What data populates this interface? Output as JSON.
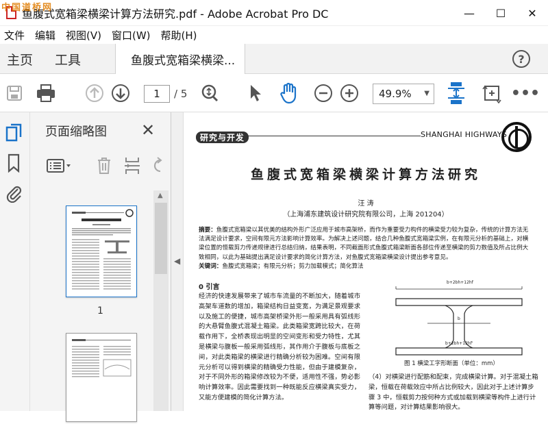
{
  "window": {
    "title": "鱼腹式宽箱梁横梁计算方法研究.pdf - Adobe Acrobat Pro DC",
    "watermark": "中国道桥网",
    "minimize": "—",
    "maximize": "☐",
    "close": "✕"
  },
  "menu": [
    "文件",
    "编辑",
    "视图(V)",
    "窗口(W)",
    "帮助(H)"
  ],
  "tabs": {
    "home": "主页",
    "tools": "工具",
    "document": "鱼腹式宽箱梁横梁..."
  },
  "toolbar": {
    "current_page": "1",
    "total_pages": "/ 5",
    "zoom": "49.9%"
  },
  "side_panel": {
    "title": "页面缩略图",
    "thumb_1_label": "1"
  },
  "paper": {
    "journal_cn": "研究与开发",
    "journal_en": "SHANGHAI HIGHWAYS",
    "title": "鱼腹式宽箱梁横梁计算方法研究",
    "author": "汪  涛",
    "affiliation": "（上海浦东建筑设计研究院有限公司，上海  201204）",
    "abstract_label": "摘要：",
    "abstract": "鱼腹式宽箱梁以其优美的结构外形广泛应用于城市高架桥，而作为重要受力构件的横梁受力较为复杂，传统的计算方法无法满足设计要求，空间有限元方法影响计算效率。为解决上述问题，结合几种鱼腹式宽箱梁实例，在有限元分析的基础上，对横梁位置的恒载剪力传递规律进行总结归纳，结果表明，不同截面形式鱼腹式箱梁断面各部位传递至横梁的剪力数值及所占比例大致相同，以此为基础提出满足设计要求的简化计算方法，对鱼腹式宽箱梁横梁设计提出参考意见。",
    "keywords_label": "关键词：",
    "keywords": "鱼腹式宽箱梁；有限元分析；剪力加载模式；简化算法",
    "section_head": "0   引言",
    "body_left": "经济的快速发展带来了城市车流量的不断加大，随着城市高架车道数的增加，箱梁结构日益变宽，为满足景观要求以及施工的便捷，城市高架桥梁外形一般采用具有弧线形的大悬臂鱼腹式混凝土箱梁。此类箱梁宽跨比较大，在荷载作用下，全桥表现出明显的空间变形和受力特性，尤其是横梁与腹板一般采用弧线形，其作用介于腹板与底板之间，对此类箱梁的横梁进行精确分析较为困难。空间有限元分析可以得到横梁的精确受力性能，但由于建模复杂，对于不同外形的箱梁修改较为不便，适用性不强，势必影响计算效率。因此需要找到一种既能反应横梁真实受力，又能方便建模的简化计算方法。",
    "fig_top_label": "b+2bh+12hf",
    "fig_mid_label": "b",
    "fig_bottom_label": "b+2bh+12hf'",
    "fig_caption": "图 1   横梁工字形断面（单位：mm）",
    "body_right": "（4）对横梁进行配筋和配束，完成横梁计算。对于混凝土箱梁，恒载在荷载效应中所占比例较大，因此对于上述计算步骤 3 中，恒载剪力按何种方式或加载到横梁等构件上进行计算等问题，对计算结果影响很大。"
  },
  "colors": {
    "acrobat_red": "#cc2222",
    "selected_blue": "#1a73c9",
    "toolbar_bg": "#f2f2f2"
  }
}
